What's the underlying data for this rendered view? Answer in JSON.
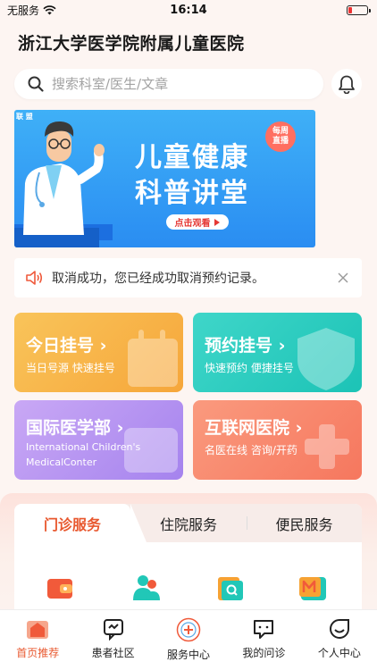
{
  "status_bar": {
    "carrier": "无服务",
    "time": "16:14",
    "battery_level": 0.2
  },
  "header": {
    "title": "浙江大学医学院附属儿童医院"
  },
  "search": {
    "placeholder": "搜索科室/医生/文章"
  },
  "banner": {
    "logo_text": "联 盟",
    "line1": "儿童健康",
    "line2": "科普讲堂",
    "tag_line1": "每周",
    "tag_line2": "直播",
    "cta": "点击观看"
  },
  "notice": {
    "text": "取消成功，您已经成功取消预约记录。"
  },
  "cards": [
    {
      "title": "今日挂号",
      "subtitle": "当日号源 快速挂号",
      "color_from": "#f9c45a",
      "color_to": "#f6a63a"
    },
    {
      "title": "预约挂号",
      "subtitle": "快速预约 便捷挂号",
      "color_from": "#3fd6c9",
      "color_to": "#1cc3b6"
    },
    {
      "title": "国际医学部",
      "subtitle_line1": "International Children's",
      "subtitle_line2": "MedicalConter",
      "color_from": "#c9a8f5",
      "color_to": "#a583ee"
    },
    {
      "title": "互联网医院",
      "subtitle": "名医在线 咨询/开药",
      "color_from": "#fa9a7e",
      "color_to": "#f6775e"
    }
  ],
  "service_tabs": [
    "门诊服务",
    "住院服务",
    "便民服务"
  ],
  "service_icons": [
    "wallet-icon",
    "people-icon",
    "search-report-icon",
    "m-badge-icon"
  ],
  "bottom_nav": [
    {
      "label": "首页推荐",
      "icon": "home-icon",
      "active": true
    },
    {
      "label": "患者社区",
      "icon": "chat-icon",
      "active": false
    },
    {
      "label": "服务中心",
      "icon": "hospital-logo-icon",
      "active": false
    },
    {
      "label": "我的问诊",
      "icon": "consult-icon",
      "active": false
    },
    {
      "label": "个人中心",
      "icon": "smile-icon",
      "active": false
    }
  ],
  "colors": {
    "accent": "#e8582f",
    "banner_blue": "#2a8df2"
  }
}
